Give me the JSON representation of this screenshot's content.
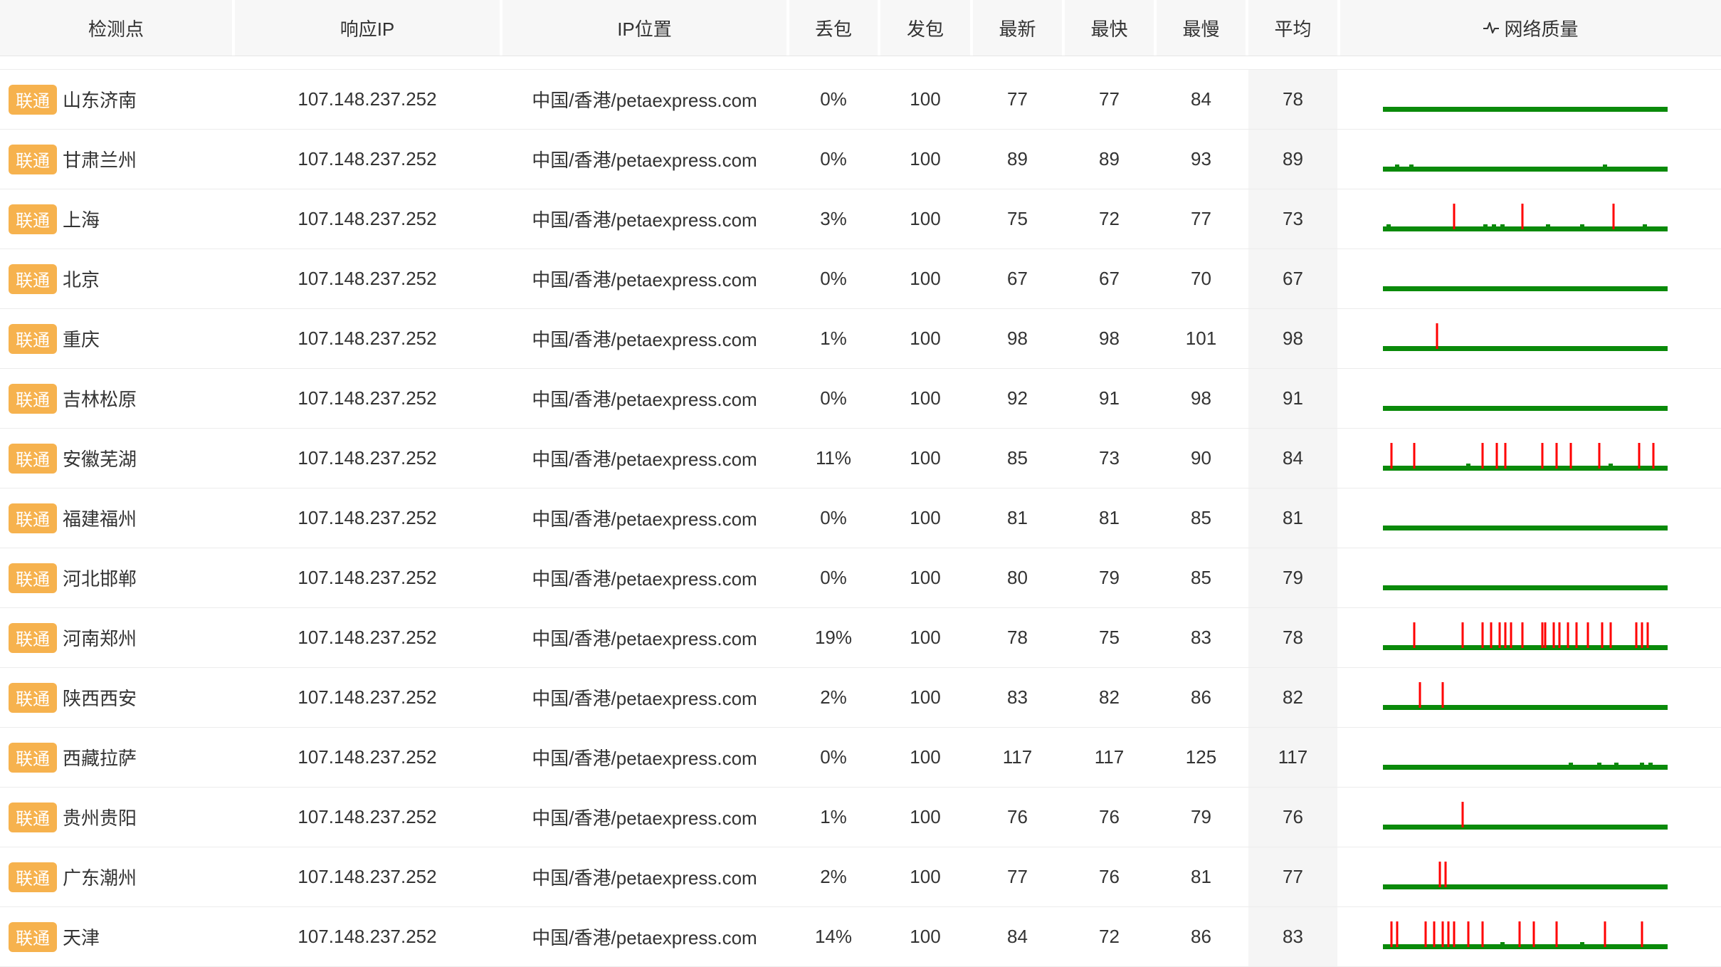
{
  "columns": [
    "检测点",
    "响应IP",
    "IP位置",
    "丢包",
    "发包",
    "最新",
    "最快",
    "最慢",
    "平均",
    "网络质量"
  ],
  "colors": {
    "isp_badge": "#f6b24e",
    "ok_line": "#0a8a0a",
    "loss_spike": "#ff0000"
  },
  "header_icon": "pulse-icon",
  "rows": [
    {
      "isp": "联通",
      "location": "山东济南",
      "ip": "107.148.237.252",
      "geo": "中国/香港/petaexpress.com",
      "loss": "0%",
      "sent": "100",
      "latest": "77",
      "fastest": "77",
      "slowest": "84",
      "avg": "78",
      "loss_spikes": [],
      "small_bumps": []
    },
    {
      "isp": "联通",
      "location": "甘肃兰州",
      "ip": "107.148.237.252",
      "geo": "中国/香港/petaexpress.com",
      "loss": "0%",
      "sent": "100",
      "latest": "89",
      "fastest": "89",
      "slowest": "93",
      "avg": "89",
      "loss_spikes": [],
      "small_bumps": [
        0.05,
        0.1,
        0.78
      ]
    },
    {
      "isp": "联通",
      "location": "上海",
      "ip": "107.148.237.252",
      "geo": "中国/香港/petaexpress.com",
      "loss": "3%",
      "sent": "100",
      "latest": "75",
      "fastest": "72",
      "slowest": "77",
      "avg": "73",
      "loss_spikes": [
        0.25,
        0.49,
        0.81
      ],
      "small_bumps": [
        0.02,
        0.36,
        0.39,
        0.42,
        0.58,
        0.7,
        0.92
      ]
    },
    {
      "isp": "联通",
      "location": "北京",
      "ip": "107.148.237.252",
      "geo": "中国/香港/petaexpress.com",
      "loss": "0%",
      "sent": "100",
      "latest": "67",
      "fastest": "67",
      "slowest": "70",
      "avg": "67",
      "loss_spikes": [],
      "small_bumps": []
    },
    {
      "isp": "联通",
      "location": "重庆",
      "ip": "107.148.237.252",
      "geo": "中国/香港/petaexpress.com",
      "loss": "1%",
      "sent": "100",
      "latest": "98",
      "fastest": "98",
      "slowest": "101",
      "avg": "98",
      "loss_spikes": [
        0.19
      ],
      "small_bumps": []
    },
    {
      "isp": "联通",
      "location": "吉林松原",
      "ip": "107.148.237.252",
      "geo": "中国/香港/petaexpress.com",
      "loss": "0%",
      "sent": "100",
      "latest": "92",
      "fastest": "91",
      "slowest": "98",
      "avg": "91",
      "loss_spikes": [],
      "small_bumps": []
    },
    {
      "isp": "联通",
      "location": "安徽芜湖",
      "ip": "107.148.237.252",
      "geo": "中国/香港/petaexpress.com",
      "loss": "11%",
      "sent": "100",
      "latest": "85",
      "fastest": "73",
      "slowest": "90",
      "avg": "84",
      "loss_spikes": [
        0.03,
        0.11,
        0.35,
        0.4,
        0.43,
        0.56,
        0.61,
        0.66,
        0.76,
        0.9,
        0.95
      ],
      "small_bumps": [
        0.3,
        0.8
      ]
    },
    {
      "isp": "联通",
      "location": "福建福州",
      "ip": "107.148.237.252",
      "geo": "中国/香港/petaexpress.com",
      "loss": "0%",
      "sent": "100",
      "latest": "81",
      "fastest": "81",
      "slowest": "85",
      "avg": "81",
      "loss_spikes": [],
      "small_bumps": []
    },
    {
      "isp": "联通",
      "location": "河北邯郸",
      "ip": "107.148.237.252",
      "geo": "中国/香港/petaexpress.com",
      "loss": "0%",
      "sent": "100",
      "latest": "80",
      "fastest": "79",
      "slowest": "85",
      "avg": "79",
      "loss_spikes": [],
      "small_bumps": []
    },
    {
      "isp": "联通",
      "location": "河南郑州",
      "ip": "107.148.237.252",
      "geo": "中国/香港/petaexpress.com",
      "loss": "19%",
      "sent": "100",
      "latest": "78",
      "fastest": "75",
      "slowest": "83",
      "avg": "78",
      "loss_spikes": [
        0.11,
        0.28,
        0.35,
        0.38,
        0.41,
        0.43,
        0.45,
        0.49,
        0.56,
        0.57,
        0.6,
        0.62,
        0.65,
        0.68,
        0.72,
        0.77,
        0.8,
        0.89,
        0.91,
        0.93
      ],
      "small_bumps": []
    },
    {
      "isp": "联通",
      "location": "陕西西安",
      "ip": "107.148.237.252",
      "geo": "中国/香港/petaexpress.com",
      "loss": "2%",
      "sent": "100",
      "latest": "83",
      "fastest": "82",
      "slowest": "86",
      "avg": "82",
      "loss_spikes": [
        0.13,
        0.21
      ],
      "small_bumps": []
    },
    {
      "isp": "联通",
      "location": "西藏拉萨",
      "ip": "107.148.237.252",
      "geo": "中国/香港/petaexpress.com",
      "loss": "0%",
      "sent": "100",
      "latest": "117",
      "fastest": "117",
      "slowest": "125",
      "avg": "117",
      "loss_spikes": [],
      "small_bumps": [
        0.66,
        0.76,
        0.82,
        0.91,
        0.94
      ]
    },
    {
      "isp": "联通",
      "location": "贵州贵阳",
      "ip": "107.148.237.252",
      "geo": "中国/香港/petaexpress.com",
      "loss": "1%",
      "sent": "100",
      "latest": "76",
      "fastest": "76",
      "slowest": "79",
      "avg": "76",
      "loss_spikes": [
        0.28
      ],
      "small_bumps": []
    },
    {
      "isp": "联通",
      "location": "广东潮州",
      "ip": "107.148.237.252",
      "geo": "中国/香港/petaexpress.com",
      "loss": "2%",
      "sent": "100",
      "latest": "77",
      "fastest": "76",
      "slowest": "81",
      "avg": "77",
      "loss_spikes": [
        0.2,
        0.22
      ],
      "small_bumps": []
    },
    {
      "isp": "联通",
      "location": "天津",
      "ip": "107.148.237.252",
      "geo": "中国/香港/petaexpress.com",
      "loss": "14%",
      "sent": "100",
      "latest": "84",
      "fastest": "72",
      "slowest": "86",
      "avg": "83",
      "loss_spikes": [
        0.03,
        0.05,
        0.15,
        0.18,
        0.21,
        0.23,
        0.25,
        0.3,
        0.35,
        0.48,
        0.53,
        0.61,
        0.78,
        0.91
      ],
      "small_bumps": [
        0.42,
        0.7
      ]
    }
  ]
}
